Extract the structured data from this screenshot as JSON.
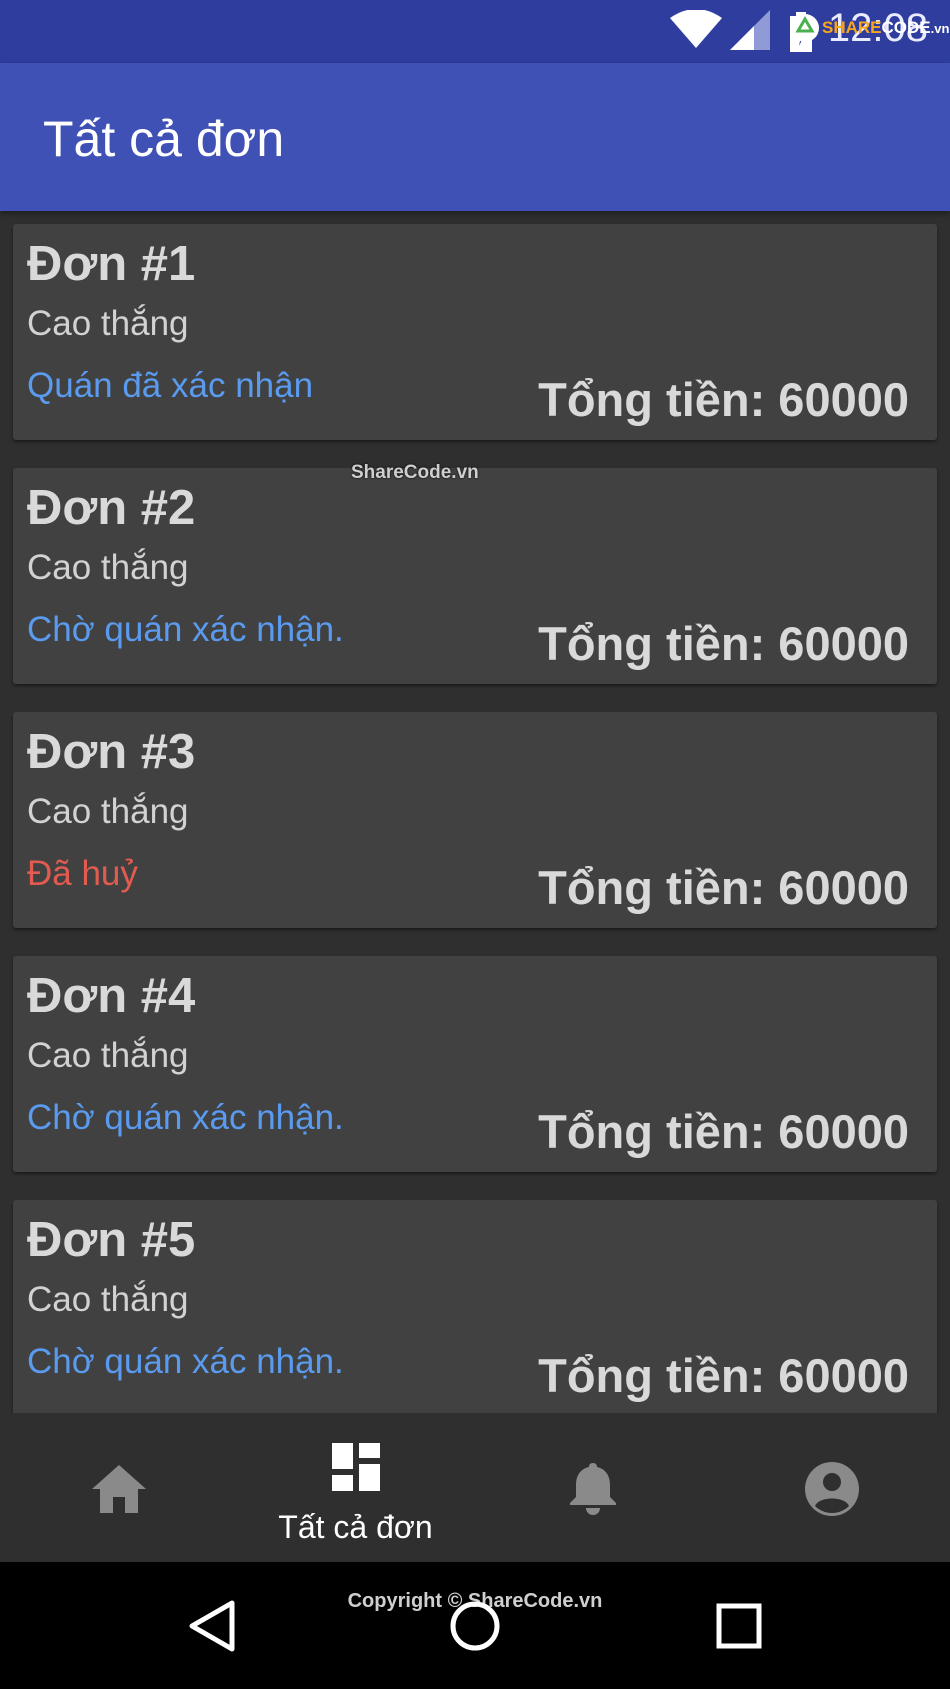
{
  "status_bar": {
    "time": "12:08",
    "watermark": {
      "share": "SHARE",
      "code": "CODE",
      "domain": ".vn"
    }
  },
  "app_bar": {
    "title": "Tất cả đơn"
  },
  "orders": [
    {
      "title": "Đơn #1",
      "customer": "Cao thắng",
      "status": "Quán đã xác nhận",
      "status_color": "#5a9bef",
      "total": "Tổng tiền: 60000"
    },
    {
      "title": "Đơn #2",
      "customer": "Cao thắng",
      "status": "Chờ quán xác nhận.",
      "status_color": "#5a9bef",
      "total": "Tổng tiền: 60000"
    },
    {
      "title": "Đơn #3",
      "customer": "Cao thắng",
      "status": "Đã huỷ",
      "status_color": "#e25b50",
      "total": "Tổng tiền: 60000"
    },
    {
      "title": "Đơn #4",
      "customer": "Cao thắng",
      "status": "Chờ quán xác nhận.",
      "status_color": "#5a9bef",
      "total": "Tổng tiền: 60000"
    },
    {
      "title": "Đơn #5",
      "customer": "Cao thắng",
      "status": "Chờ quán xác nhận.",
      "status_color": "#5a9bef",
      "total": "Tổng tiền: 60000"
    }
  ],
  "watermark_center": "ShareCode.vn",
  "bottom_nav": {
    "items": [
      {
        "icon": "home-icon",
        "label": ""
      },
      {
        "icon": "dashboard-icon",
        "label": "Tất cả đơn",
        "selected": true
      },
      {
        "icon": "bell-icon",
        "label": ""
      },
      {
        "icon": "account-icon",
        "label": ""
      }
    ]
  },
  "system_nav": {
    "copyright": "Copyright © ShareCode.vn"
  },
  "colors": {
    "status_bar": "#2f3d9f",
    "app_bar": "#3f51b5",
    "background": "#2f2f2f",
    "card": "#414141",
    "accent_blue": "#5a9bef",
    "accent_red": "#e25b50"
  }
}
